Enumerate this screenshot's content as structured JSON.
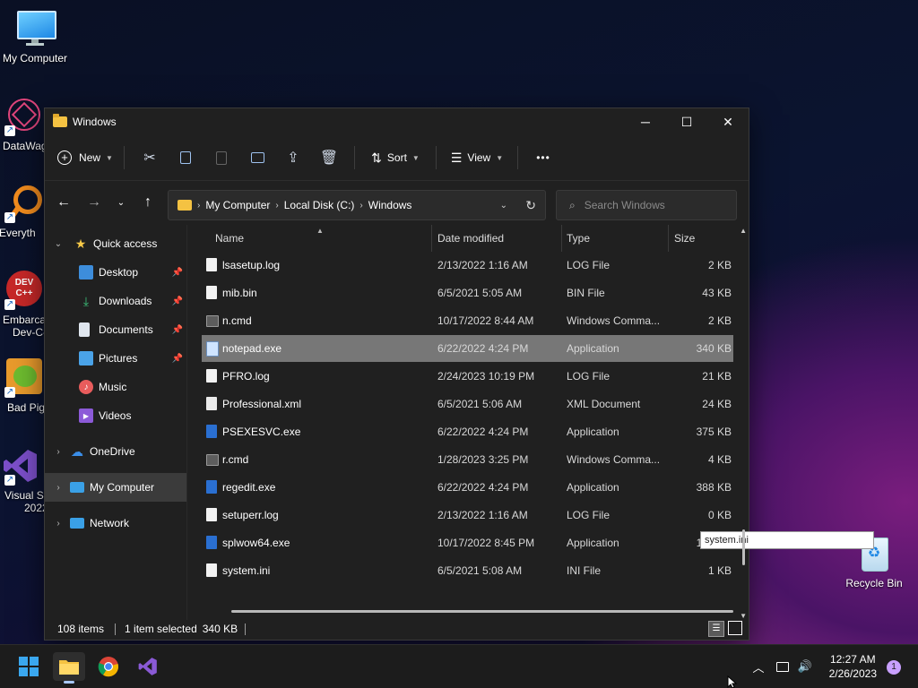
{
  "desktop": {
    "icons": [
      {
        "label": "My Computer"
      },
      {
        "label": "DataWag"
      },
      {
        "label": "Everyth"
      },
      {
        "label": "Embarca",
        "label2": "Dev-C-"
      },
      {
        "label": "Bad Pig"
      },
      {
        "label": "Visual St",
        "label2": "2022"
      },
      {
        "label": "Recycle Bin"
      }
    ]
  },
  "window": {
    "title": "Windows",
    "toolbar": {
      "new_label": "New",
      "sort_label": "Sort",
      "view_label": "View",
      "more_label": "•••"
    },
    "address": {
      "crumbs": [
        "My Computer",
        "Local Disk (C:)",
        "Windows"
      ]
    },
    "search": {
      "placeholder": "Search Windows"
    },
    "nav": {
      "items": [
        {
          "label": "Quick access"
        },
        {
          "label": "Desktop"
        },
        {
          "label": "Downloads"
        },
        {
          "label": "Documents"
        },
        {
          "label": "Pictures"
        },
        {
          "label": "Music"
        },
        {
          "label": "Videos"
        },
        {
          "label": "OneDrive"
        },
        {
          "label": "My Computer"
        },
        {
          "label": "Network"
        }
      ]
    },
    "columns": [
      "Name",
      "Date modified",
      "Type",
      "Size"
    ],
    "files": [
      {
        "name": "lsasetup.log",
        "date": "2/13/2022 1:16 AM",
        "type": "LOG File",
        "size": "2 KB"
      },
      {
        "name": "mib.bin",
        "date": "6/5/2021 5:05 AM",
        "type": "BIN File",
        "size": "43 KB"
      },
      {
        "name": "n.cmd",
        "date": "10/17/2022 8:44 AM",
        "type": "Windows Comma...",
        "size": "2 KB"
      },
      {
        "name": "notepad.exe",
        "date": "6/22/2022 4:24 PM",
        "type": "Application",
        "size": "340 KB"
      },
      {
        "name": "PFRO.log",
        "date": "2/24/2023 10:19 PM",
        "type": "LOG File",
        "size": "21 KB"
      },
      {
        "name": "Professional.xml",
        "date": "6/5/2021 5:06 AM",
        "type": "XML Document",
        "size": "24 KB"
      },
      {
        "name": "PSEXESVC.exe",
        "date": "6/22/2022 4:24 PM",
        "type": "Application",
        "size": "375 KB"
      },
      {
        "name": "r.cmd",
        "date": "1/28/2023 3:25 PM",
        "type": "Windows Comma...",
        "size": "4 KB"
      },
      {
        "name": "regedit.exe",
        "date": "6/22/2022 4:24 PM",
        "type": "Application",
        "size": "388 KB"
      },
      {
        "name": "setuperr.log",
        "date": "2/13/2022 1:16 AM",
        "type": "LOG File",
        "size": "0 KB"
      },
      {
        "name": "splwow64.exe",
        "date": "10/17/2022 8:45 PM",
        "type": "Application",
        "size": "188 KB"
      },
      {
        "name": "system.ini",
        "date": "6/5/2021 5:08 AM",
        "type": "INI File",
        "size": "1 KB"
      }
    ],
    "tooltip": "system.ini",
    "status": {
      "items": "108 items",
      "selected": "1 item selected",
      "size": "340 KB"
    }
  },
  "taskbar": {
    "time": "12:27 AM",
    "date": "2/26/2023",
    "notification_count": "1"
  }
}
